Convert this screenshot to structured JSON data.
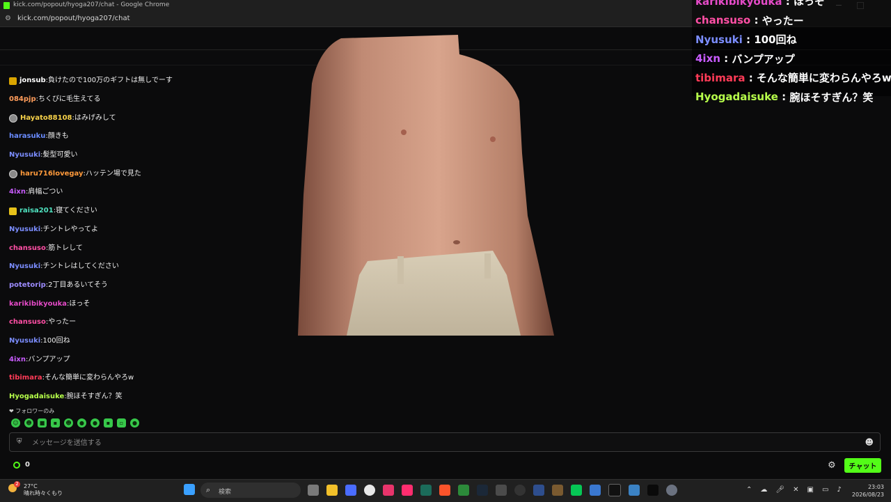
{
  "window": {
    "title": "kick.com/popout/hyoga207/chat - Google Chrome",
    "url": "kick.com/popout/hyoga207/chat"
  },
  "chat": {
    "messages": [
      {
        "badge": "gold",
        "user": "jonsub",
        "color": "#ffffff",
        "text": "負けたので100万のギフトは無しでーす"
      },
      {
        "badge": "",
        "user": "084pjp",
        "color": "#ff9c5b",
        "text": "ちくびに毛生えてる"
      },
      {
        "badge": "avatar",
        "user": "Hayato88108",
        "color": "#f7d24a",
        "text": "はみげみして"
      },
      {
        "badge": "",
        "user": "harasuku",
        "color": "#6a8cff",
        "text": "顔きも"
      },
      {
        "badge": "",
        "user": "Nyusuki",
        "color": "#7b8dff",
        "text": "髪型可愛い"
      },
      {
        "badge": "avatar",
        "user": "haru716lovegay",
        "color": "#ff9a3b",
        "text": "ハッテン場で見た"
      },
      {
        "badge": "",
        "user": "4ixn",
        "color": "#c95cff",
        "text": "肩幅ごつい"
      },
      {
        "badge": "gift",
        "user": "raisa201",
        "color": "#4fe3c0",
        "text": "寝てください"
      },
      {
        "badge": "",
        "user": "Nyusuki",
        "color": "#7b8dff",
        "text": "チントレやってよ"
      },
      {
        "badge": "",
        "user": "chansuso",
        "color": "#ff4fa5",
        "text": "筋トレして"
      },
      {
        "badge": "",
        "user": "Nyusuki",
        "color": "#7b8dff",
        "text": "チントレはしてください"
      },
      {
        "badge": "",
        "user": "potetorip",
        "color": "#9d8cff",
        "text": "2丁目あるいてそう"
      },
      {
        "badge": "",
        "user": "karikibikyouka",
        "color": "#e54bc8",
        "text": "ほっそ"
      },
      {
        "badge": "",
        "user": "chansuso",
        "color": "#ff4fa5",
        "text": "やったー"
      },
      {
        "badge": "",
        "user": "Nyusuki",
        "color": "#7b8dff",
        "text": "100回ね"
      },
      {
        "badge": "",
        "user": "4ixn",
        "color": "#c95cff",
        "text": "バンプアップ"
      },
      {
        "badge": "",
        "user": "tibimara",
        "color": "#ff3b57",
        "text": "そんな簡単に変わらんやろw"
      },
      {
        "badge": "",
        "user": "Hyogadaisuke",
        "color": "#b6ff4a",
        "text": "腕ほそすぎん？笑"
      }
    ],
    "follower_only_label": "フォロワーのみ",
    "input_placeholder": "メッセージを送信する",
    "points_value": "0",
    "send_button_label": "チャット"
  },
  "overlay": {
    "messages": [
      {
        "user": "karikibikyouka",
        "color": "#e54bc8",
        "text": "ほっそ"
      },
      {
        "user": "chansuso",
        "color": "#ff4fa5",
        "text": "やったー"
      },
      {
        "user": "Nyusuki",
        "color": "#7b8dff",
        "text": "100回ね"
      },
      {
        "user": "4ixn",
        "color": "#c95cff",
        "text": "バンプアップ"
      },
      {
        "user": "tibimara",
        "color": "#ff3b57",
        "text": "そんな簡単に変わらんやろw"
      },
      {
        "user": "Hyogadaisuke",
        "color": "#b6ff4a",
        "text": "腕ほそすぎん？笑"
      }
    ]
  },
  "taskbar": {
    "weather_temp": "27°C",
    "weather_desc": "晴れ時々くもり",
    "weather_alert_count": "2",
    "search_placeholder": "検索",
    "time": "23:03",
    "date": "2026/08/23"
  }
}
